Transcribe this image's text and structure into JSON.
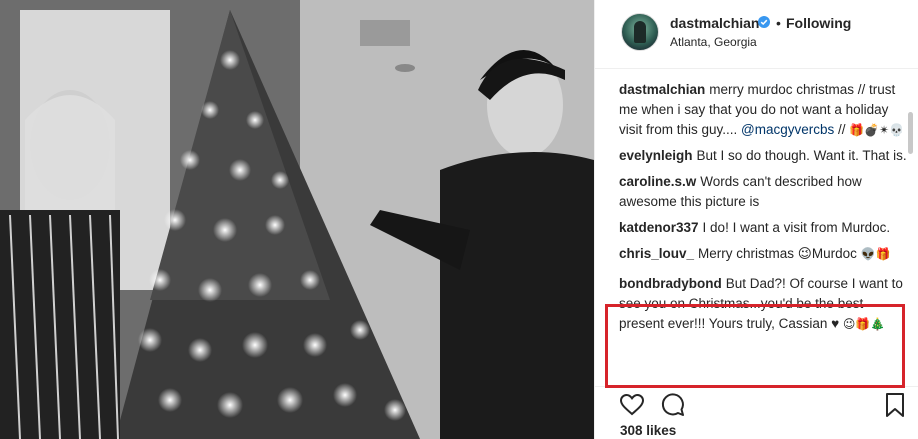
{
  "post": {
    "username": "dastmalchian",
    "follow_separator": "•",
    "follow_status": "Following",
    "location": "Atlanta, Georgia",
    "likes": "308 likes"
  },
  "caption": {
    "user": "dastmalchian",
    "text": "merry murdoc christmas // trust me when i say that you do not want a holiday visit from this guy.... ",
    "mention": "@macgyvercbs",
    "tail": " // ",
    "emoji": "🎁💣✴💀"
  },
  "comments": [
    {
      "user": "evelynleigh",
      "text": "But I so do though. Want it. That is.",
      "emoji": ""
    },
    {
      "user": "caroline.s.w",
      "text": "Words can't described how awesome this picture is",
      "emoji": ""
    },
    {
      "user": "katdenor337",
      "text": "I do! I want a visit from Murdoc.",
      "emoji": ""
    },
    {
      "user": "chris_louv_",
      "text": "Merry christmas 😉Murdoc ",
      "emoji": "👽🎁"
    },
    {
      "user": "bondbradybond",
      "text": "But Dad?! Of course I want to see you on Christmas...you'd be the best present ever!!! Yours truly, Cassian ♥ ",
      "emoji": "😉🎁🎄"
    }
  ],
  "colors": {
    "highlight_border": "#d6232a",
    "verified_badge": "#3897f0",
    "mention": "#003569"
  },
  "icons": [
    "verified-badge-icon",
    "heart-icon",
    "comment-icon",
    "bookmark-icon"
  ]
}
